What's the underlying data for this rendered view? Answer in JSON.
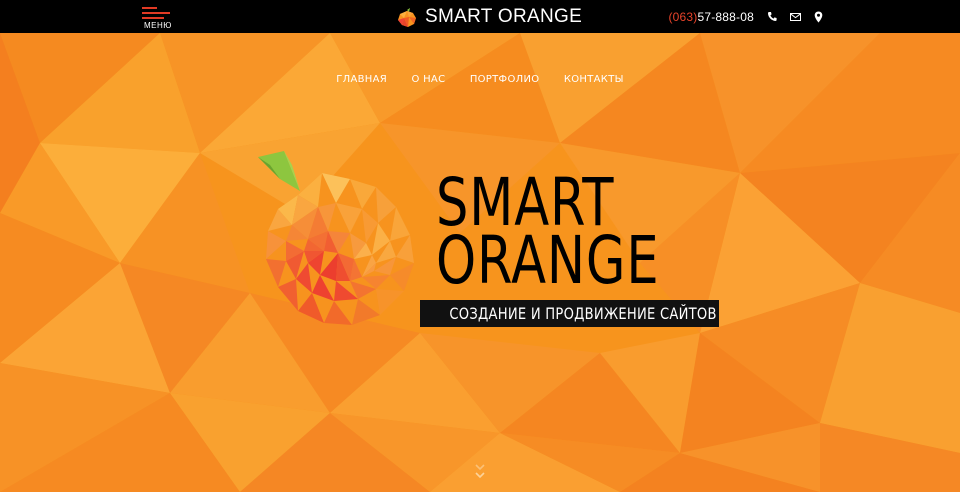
{
  "header": {
    "menu_label": "МЕНЮ",
    "brand_name": "SMART ORANGE",
    "phone_code": "(063)",
    "phone_number": "57-888-08",
    "icons": [
      "phone-icon",
      "mail-icon",
      "location-pin-icon"
    ]
  },
  "nav": {
    "items": [
      {
        "label": "ГЛАВНАЯ"
      },
      {
        "label": "О НАС"
      },
      {
        "label": "ПОРТФОЛИО"
      },
      {
        "label": "КОНТАКТЫ"
      }
    ]
  },
  "hero": {
    "title_line1": "SMART",
    "title_line2": "ORANGE",
    "tagline": "СОЗДАНИЕ И ПРОДВИЖЕНИЕ САЙТОВ",
    "scroll_icon": "double-chevron-down-icon"
  },
  "colors": {
    "topbar": "#000000",
    "accent_red": "#e23a24",
    "background_orange": "#f7931e",
    "tagline_bg": "#111111"
  }
}
